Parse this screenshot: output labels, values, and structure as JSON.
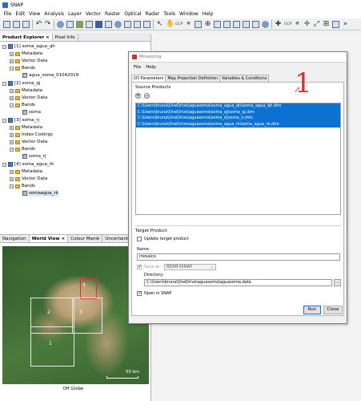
{
  "app": {
    "title": "SNAP"
  },
  "menu": [
    "File",
    "Edit",
    "View",
    "Analysis",
    "Layer",
    "Vector",
    "Raster",
    "Optical",
    "Radar",
    "Tools",
    "Window",
    "Help"
  ],
  "toolbar": {
    "gcp_labels": [
      "GCP",
      "GCP"
    ]
  },
  "explorer": {
    "tabs": [
      "Product Explorer",
      "Pixel Info"
    ],
    "close_glyph": "×",
    "tree": [
      {
        "label": "[1] soma_agua_qh",
        "kind": "product"
      },
      {
        "label": "Metadata",
        "kind": "folder"
      },
      {
        "label": "Vector Data",
        "kind": "folder"
      },
      {
        "label": "Bands",
        "kind": "folder"
      },
      {
        "label": "agua_soma_01042019",
        "kind": "band"
      },
      {
        "label": "[2] soma_qj",
        "kind": "product"
      },
      {
        "label": "Metadata",
        "kind": "folder"
      },
      {
        "label": "Vector Data",
        "kind": "folder"
      },
      {
        "label": "Bands",
        "kind": "folder"
      },
      {
        "label": "soma",
        "kind": "band"
      },
      {
        "label": "[3] soma_rj",
        "kind": "product"
      },
      {
        "label": "Metadata",
        "kind": "folder"
      },
      {
        "label": "Index Codings",
        "kind": "folder"
      },
      {
        "label": "Vector Data",
        "kind": "folder"
      },
      {
        "label": "Bands",
        "kind": "folder"
      },
      {
        "label": "soma_rj",
        "kind": "band"
      },
      {
        "label": "[4] soma_agua_rk",
        "kind": "product"
      },
      {
        "label": "Metadata",
        "kind": "folder"
      },
      {
        "label": "Vector Data",
        "kind": "folder"
      },
      {
        "label": "Bands",
        "kind": "folder"
      },
      {
        "label": "somaagua_rk",
        "kind": "band"
      }
    ]
  },
  "navpanel": {
    "tabs": [
      "Navigation",
      "World View",
      "Colour Manié",
      "Uncertainty"
    ],
    "tile_numbers": [
      "4",
      "2",
      "3",
      "1"
    ],
    "scale_label": "50 km",
    "footer": "Off Globe"
  },
  "dialog": {
    "title": "Mosaicing",
    "menu": [
      "File",
      "Help"
    ],
    "tabs": [
      "I/O Parameters",
      "Map Projection Definition",
      "Variables & Conditions"
    ],
    "source_products_label": "Source Products",
    "add_glyph": "+",
    "remove_glyph": "−",
    "source_products": [
      "C:\\Users\\bruna\\OneDrive\\aguasoma\\soma_agua_qh\\soma_agua_qh.dim",
      "C:\\Users\\bruna\\OneDrive\\aguasoma\\soma_qj\\soma_qj.dim",
      "C:\\Users\\bruna\\OneDrive\\aguasoma\\soma_rj\\soma_rj.dim",
      "C:\\Users\\bruna\\OneDrive\\aguasoma\\soma_agua_rk\\soma_agua_rk.dim"
    ],
    "annotation": "1",
    "target_product_label": "Target Product",
    "update_target_label": "Update target product",
    "name_label": "Name:",
    "name_value": "mosaico",
    "save_as_label": "Save as:",
    "save_as_value": "BEAM-DIMAP",
    "directory_label": "Directory:",
    "directory_value": "C:\\Users\\bruna\\OneDrive\\aguasoma\\aguasoma.data",
    "browse_label": "...",
    "open_in_snap_label": "Open in SNAP",
    "run_label": "Run",
    "close_label": "Close"
  }
}
